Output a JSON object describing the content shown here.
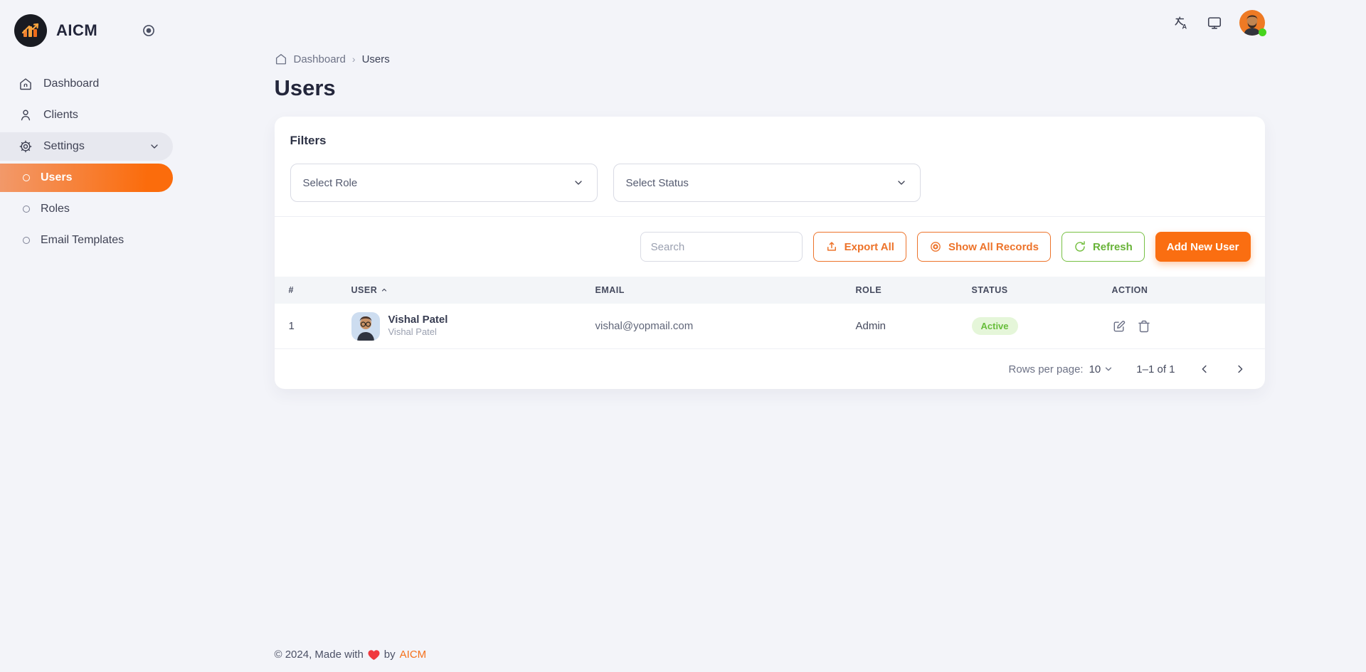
{
  "sidebar": {
    "brand": "AICM",
    "items": [
      {
        "label": "Dashboard"
      },
      {
        "label": "Clients"
      },
      {
        "label": "Settings"
      }
    ],
    "settings_children": [
      {
        "label": "Users"
      },
      {
        "label": "Roles"
      },
      {
        "label": "Email Templates"
      }
    ],
    "active_item": "Users"
  },
  "breadcrumb": {
    "home": "Dashboard",
    "separator": "›",
    "current": "Users"
  },
  "page": {
    "title": "Users"
  },
  "filters": {
    "heading": "Filters",
    "role_select_value": "Select Role",
    "status_select_value": "Select Status"
  },
  "toolbar": {
    "search_placeholder": "Search",
    "export_label": "Export All",
    "show_all_label": "Show All Records",
    "refresh_label": "Refresh",
    "add_user_label": "Add New User"
  },
  "table": {
    "columns": [
      {
        "label": "#"
      },
      {
        "label": "User",
        "sorted": "asc"
      },
      {
        "label": "Email"
      },
      {
        "label": "Role"
      },
      {
        "label": "Status"
      },
      {
        "label": "Action"
      }
    ],
    "rows": [
      {
        "index": "1",
        "name": "Vishal Patel",
        "subtitle": "Vishal Patel",
        "email": "vishal@yopmail.com",
        "role": "Admin",
        "status": "Active"
      }
    ]
  },
  "pagination": {
    "rows_per_page_label": "Rows per page:",
    "rows_per_page_value": "10",
    "range": "1–1 of 1"
  },
  "footer": {
    "text": "© 2024, Made with",
    "by": "by",
    "brand": "AICM"
  },
  "icons": {
    "logo": "dark circle with orange bar-chart and up arrow",
    "sidebar-toggle": "circle-dot record icon",
    "translate-icon": "language/translate glyph",
    "monitor-icon": "display screen",
    "avatar": "bearded man on orange circle with green online dot",
    "export-icon": "upload tray with up arrow",
    "show-all-icon": "concentric target circles",
    "refresh-icon": "circular arrows",
    "edit-icon": "pencil over square",
    "delete-icon": "trash can",
    "heart-icon": "red heart"
  },
  "colors": {
    "page_bg": "#f3f4f9",
    "accent_orange": "#f4701b",
    "add_button_bg": "#fa6e11",
    "accent_green": "#77c043",
    "status_active_bg": "#e5f6d9",
    "status_active_text": "#67bd3a",
    "sidebar_active_gradient": "linear-gradient(92deg,#f2996a,#fb6c0c)"
  }
}
